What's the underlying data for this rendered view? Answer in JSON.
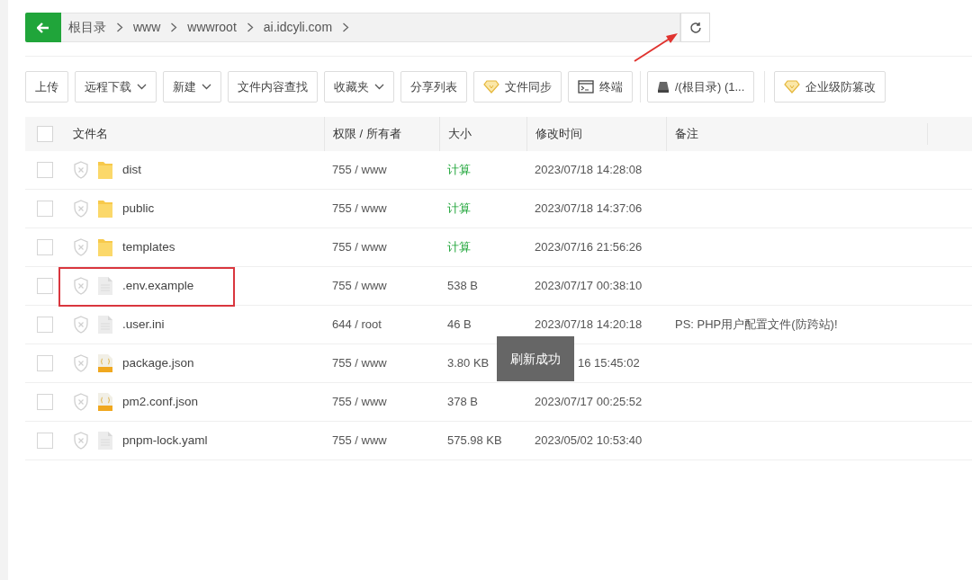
{
  "breadcrumb": {
    "segments": [
      "根目录",
      "www",
      "wwwroot",
      "ai.idcyli.com"
    ]
  },
  "toolbar": [
    {
      "label": "上传",
      "kind": "plain"
    },
    {
      "label": "远程下载",
      "kind": "dropdown"
    },
    {
      "label": "新建",
      "kind": "dropdown"
    },
    {
      "label": "文件内容查找",
      "kind": "plain"
    },
    {
      "label": "收藏夹",
      "kind": "dropdown"
    },
    {
      "label": "分享列表",
      "kind": "plain"
    },
    {
      "label": "文件同步",
      "kind": "gem"
    },
    {
      "label": "终端",
      "kind": "terminal"
    },
    {
      "label": "/(根目录) (1...",
      "kind": "disk"
    },
    {
      "label": "企业级防篡改",
      "kind": "gem"
    }
  ],
  "table": {
    "columns": [
      "文件名",
      "权限 / 所有者",
      "大小",
      "修改时间",
      "备注"
    ],
    "all_checked": false,
    "rows": [
      {
        "name": "dist",
        "kind": "folder",
        "permissions": "755 / www",
        "size": "计算",
        "modified": "2023/07/18 14:28:08",
        "checked": false,
        "highlighted": false
      },
      {
        "name": "public",
        "kind": "folder",
        "permissions": "755 / www",
        "size": "计算",
        "modified": "2023/07/18 14:37:06",
        "checked": false,
        "highlighted": false
      },
      {
        "name": "templates",
        "kind": "folder",
        "permissions": "755 / www",
        "size": "计算",
        "modified": "2023/07/16 21:56:26",
        "checked": false,
        "highlighted": false
      },
      {
        "name": ".env.example",
        "kind": "file",
        "permissions": "755 / www",
        "size": "538 B",
        "modified": "2023/07/17 00:38:10",
        "checked": false,
        "highlighted": true
      },
      {
        "name": ".user.ini",
        "kind": "file",
        "permissions": "644 / root",
        "size": "46 B",
        "modified": "2023/07/18 14:20:18",
        "remark": "PS: PHP用户配置文件(防跨站)!",
        "checked": false,
        "highlighted": false
      },
      {
        "name": "package.json",
        "kind": "json",
        "permissions": "755 / www",
        "size": "3.80 KB",
        "modified": "16 15:45:02",
        "modified_partly_covered": true,
        "checked": false,
        "highlighted": false
      },
      {
        "name": "pm2.conf.json",
        "kind": "json",
        "permissions": "755 / www",
        "size": "378 B",
        "modified": "2023/07/17 00:25:52",
        "checked": false,
        "highlighted": false
      },
      {
        "name": "pnpm-lock.yaml",
        "kind": "file",
        "permissions": "755 / www",
        "size": "575.98 KB",
        "modified": "2023/05/02 10:53:40",
        "checked": false,
        "highlighted": false
      }
    ]
  },
  "toast": {
    "text": "刷新成功"
  }
}
